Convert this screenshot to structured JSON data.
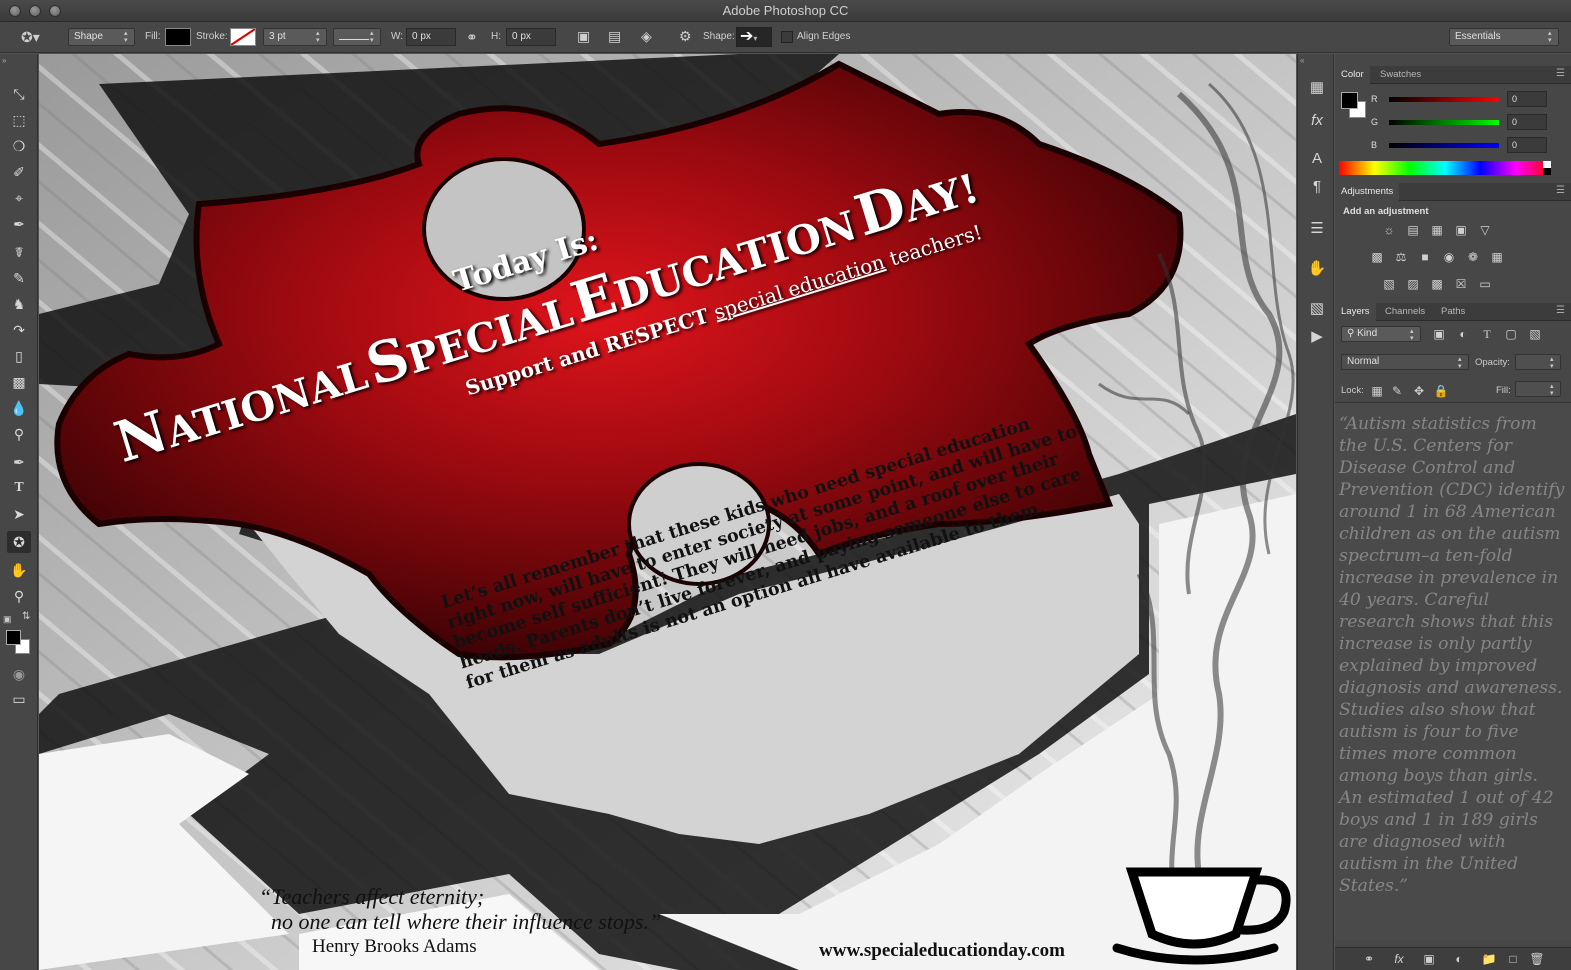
{
  "app": {
    "window_title": "Adobe Photoshop CC"
  },
  "options_bar": {
    "mode": "Shape",
    "fill_label": "Fill:",
    "stroke_label": "Stroke:",
    "stroke_width": "3 pt",
    "w_label": "W:",
    "w_value": "0 px",
    "h_label": "H:",
    "h_value": "0 px",
    "shape_label": "Shape:",
    "align_edges_label": "Align Edges",
    "workspace": "Essentials"
  },
  "poster": {
    "today_is": "Today Is:",
    "headline_n": "N",
    "headline_ational": "ATIONAL",
    "headline_s": "S",
    "headline_pecial": "PECIAL",
    "headline_e": "E",
    "headline_ducation": "DUCATION",
    "headline_d": "D",
    "headline_ay": "AY!",
    "support_1": "Support and ",
    "support_2": "RESPECT",
    "support_3": "special education",
    "support_4": " teachers!",
    "body_lines": [
      "Let’s all remember that  these kids who need special education",
      "right now, will have to enter society at some point, and will have to",
      "become self sufficient! They will need jobs, and a roof over their",
      "heads. Parents don’t live forever, and paying someone else to care",
      "for them as adults is not an option all have available to them."
    ],
    "quote_line1": "“Teachers affect eternity;",
    "quote_line2": "no one can tell where their influence stops.”",
    "quote_author": "Henry Brooks Adams",
    "website": "www.specialeducationday.com"
  },
  "color_panel": {
    "tabs": [
      "Color",
      "Swatches"
    ],
    "r_label": "R",
    "g_label": "G",
    "b_label": "B",
    "r_value": "0",
    "g_value": "0",
    "b_value": "0"
  },
  "adjustments_panel": {
    "tab": "Adjustments",
    "heading": "Add an adjustment"
  },
  "layers_panel": {
    "tabs": [
      "Layers",
      "Channels",
      "Paths"
    ],
    "kind_label": "Kind",
    "blend_mode": "Normal",
    "opacity_label": "Opacity:",
    "lock_label": "Lock:",
    "fill_label": "Fill:",
    "overlay_quote": "“Autism statistics from the U.S. Centers for Disease Control and Prevention (CDC) identify around 1 in 68 American children as on the autism spectrum–a ten-fold increase in prevalence in 40 years. Careful research shows that this increase is only partly explained by improved diagnosis and awareness. Studies also show that autism is four to five times more common among boys than girls. An estimated 1 out of 42 boys and 1 in 189 girls are diagnosed with autism in the United States.”"
  },
  "colors": {
    "ui_dark": "#474747",
    "puzzle_red": "#8e0b10",
    "puzzle_red_light": "#d4151c"
  }
}
